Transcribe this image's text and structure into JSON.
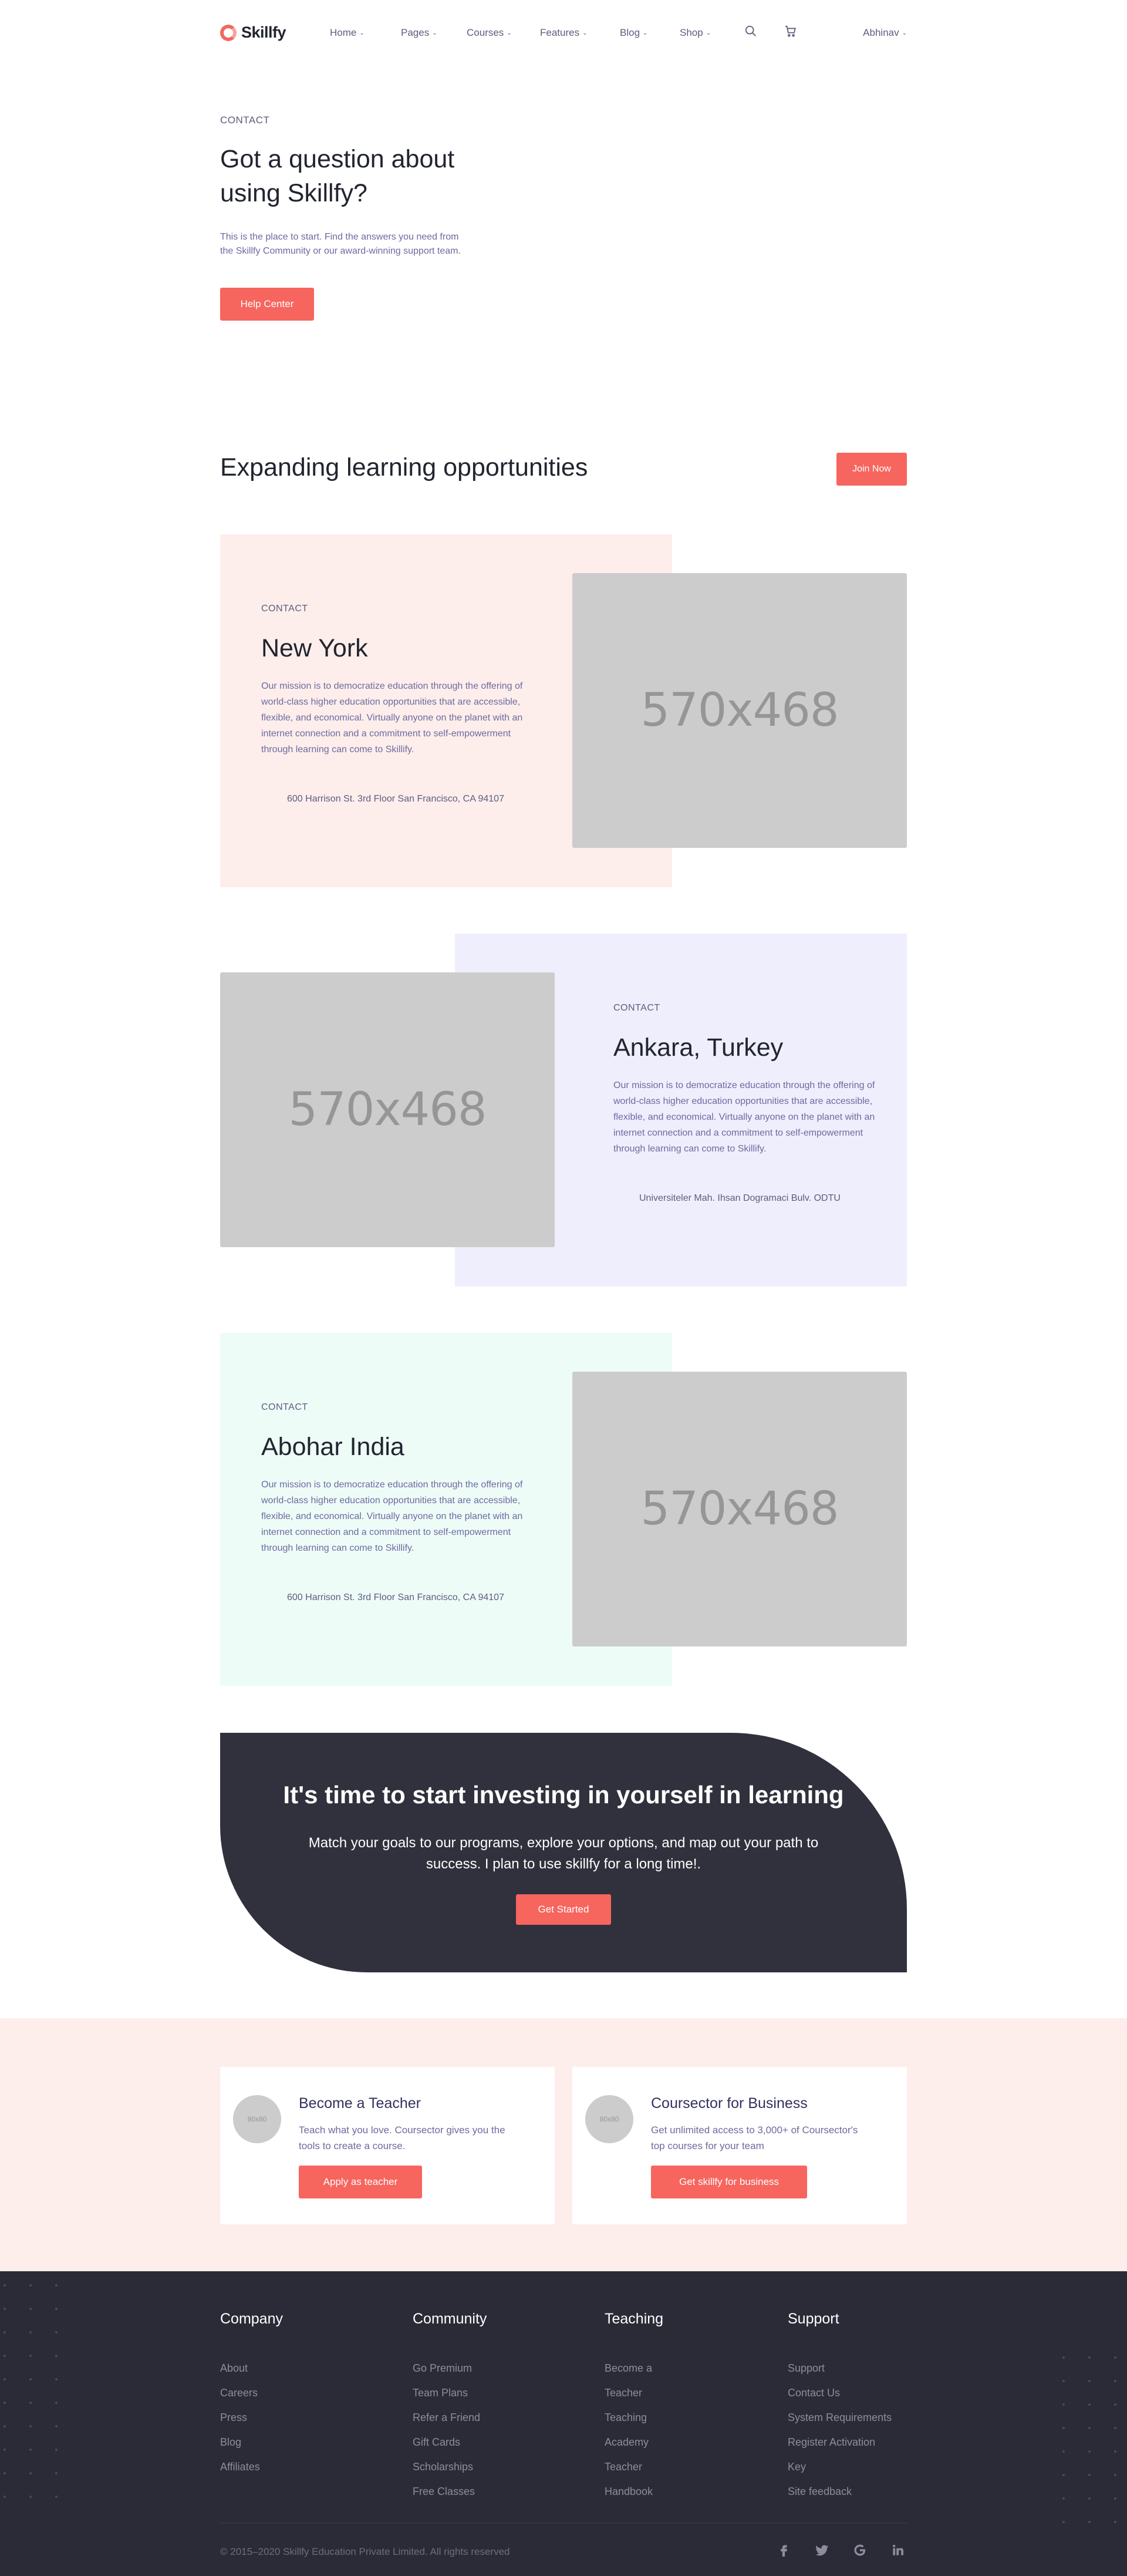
{
  "header": {
    "brand": "Skillfy",
    "nav": [
      "Home",
      "Pages",
      "Courses",
      "Features",
      "Blog",
      "Shop"
    ],
    "user": "Abhinav"
  },
  "hero": {
    "eyebrow": "CONTACT",
    "title_line1": "Got a question about",
    "title_line2": "using Skillfy?",
    "text": "This is the place to start. Find the answers you need from the Skillfy Community or our award-winning support team.",
    "button": "Help Center"
  },
  "section": {
    "title": "Expanding learning opportunities",
    "button": "Join Now"
  },
  "locations": [
    {
      "eyebrow": "CONTACT",
      "title": "New York",
      "text": "Our mission is to democratize education through the offering of world-class higher education opportunities that are accessible, flexible, and economical. Virtually anyone on the planet with an internet connection and a commitment to self-empowerment through learning can come to Skillify.",
      "address": "600 Harrison St. 3rd Floor San Francisco, CA 94107",
      "image": "570x468",
      "bg": "#fdeeeb"
    },
    {
      "eyebrow": "CONTACT",
      "title": "Ankara, Turkey",
      "text": "Our mission is to democratize education through the offering of world-class higher education opportunities that are accessible, flexible, and economical. Virtually anyone on the planet with an internet connection and a commitment to self-empowerment through learning can come to Skillify.",
      "address": "Universiteler Mah. Ihsan Dogramaci Bulv. ODTU",
      "image": "570x468",
      "bg": "#efeefd"
    },
    {
      "eyebrow": "CONTACT",
      "title": "Abohar India",
      "text": "Our mission is to democratize education through the offering of world-class higher education opportunities that are accessible, flexible, and economical. Virtually anyone on the planet with an internet connection and a commitment to self-empowerment through learning can come to Skillify.",
      "address": "600 Harrison St. 3rd Floor San Francisco, CA 94107",
      "image": "570x468",
      "bg": "#eefcf8"
    }
  ],
  "cta": {
    "title": "It's time to start investing in yourself in learning",
    "text": "Match your goals to our programs, explore your options, and map out your path to success. I plan to use skillfy for a long time!.",
    "button": "Get Started"
  },
  "cards": [
    {
      "avatar": "80x80",
      "title": "Become a Teacher",
      "text": "Teach what you love. Coursector gives you the tools to create a course.",
      "button": "Apply as teacher"
    },
    {
      "avatar": "80x80",
      "title": "Coursector for Business",
      "text": "Get unlimited access to 3,000+ of Coursector's top courses for your team",
      "button": "Get skillfy for business"
    }
  ],
  "footer": {
    "columns": [
      {
        "title": "Company",
        "links": [
          "About",
          "Careers",
          "Press",
          "Blog",
          "Affiliates"
        ]
      },
      {
        "title": "Community",
        "links": [
          "Go Premium",
          "Team Plans",
          "Refer a Friend",
          "Gift Cards",
          "Scholarships",
          "Free Classes"
        ]
      },
      {
        "title": "Teaching",
        "links": [
          "Become a",
          "Teacher",
          "Teaching",
          "Academy",
          "Teacher",
          "Handbook"
        ]
      },
      {
        "title": "Support",
        "links": [
          "Support",
          "Contact Us",
          "System Requirements",
          "Register Activation",
          "Key",
          "Site feedback"
        ]
      }
    ],
    "copyright": "© 2015–2020 Skillfy Education Private Limited. All rights reserved",
    "social": [
      "facebook-icon",
      "twitter-icon",
      "google-icon",
      "linkedin-icon"
    ]
  },
  "colors": {
    "accent": "#f6655e",
    "dark": "#31313d",
    "footer": "#2b2b37"
  }
}
